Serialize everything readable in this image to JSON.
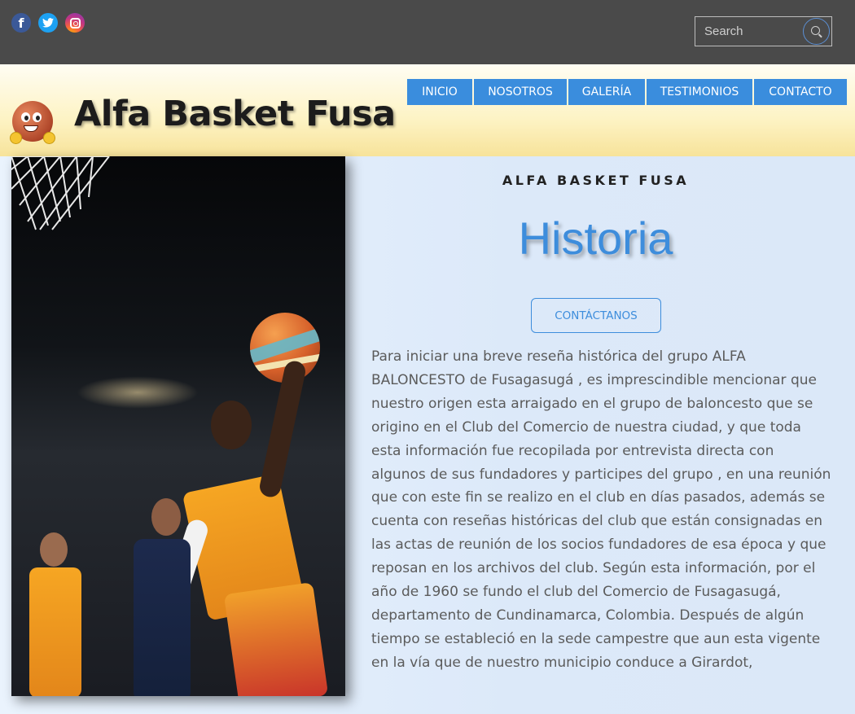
{
  "social": {
    "icons": [
      "facebook-icon",
      "twitter-icon",
      "instagram-icon"
    ],
    "facebook_glyph": "f"
  },
  "search": {
    "placeholder": "Search",
    "icon": "search-icon"
  },
  "header": {
    "title": "Alfa Basket Fusa",
    "logo": "basketball-mascot-logo"
  },
  "nav": {
    "items": [
      {
        "label": "INICIO"
      },
      {
        "label": "NOSOTROS"
      },
      {
        "label": "GALERÍA"
      },
      {
        "label": "TESTIMONIOS"
      },
      {
        "label": "CONTACTO"
      }
    ]
  },
  "main": {
    "eyebrow": "ALFA BASKET FUSA",
    "heading": "Historia",
    "cta_label": "CONTÁCTANOS",
    "paragraph": "Para iniciar una breve reseña histórica del grupo ALFA BALONCESTO de Fusagasugá , es imprescindible mencionar que nuestro origen esta arraigado en el grupo de baloncesto que se origino en el Club del Comercio de nuestra ciudad, y que toda esta información fue recopilada por entrevista directa con algunos de sus fundadores y participes del grupo , en una reunión que con este fin se realizo en el club en días pasados, además se cuenta con reseñas históricas del club que están consignadas en las actas de reunión de los socios fundadores de esa época y que reposan en los archivos del club. Según esta información, por el año de 1960 se fundo el club del Comercio de Fusagasugá, departamento de Cundinamarca, Colombia. Después de algún tiempo se estableció en la sede campestre que aun esta vigente en la vía que de nuestro municipio conduce a Girardot,"
  },
  "colors": {
    "topbar": "#4a4a4a",
    "nav_bg": "#3a8ddd",
    "accent": "#3d8ddc",
    "body_text": "#5b5b5b",
    "header_gradient_end": "#f7e39a"
  }
}
